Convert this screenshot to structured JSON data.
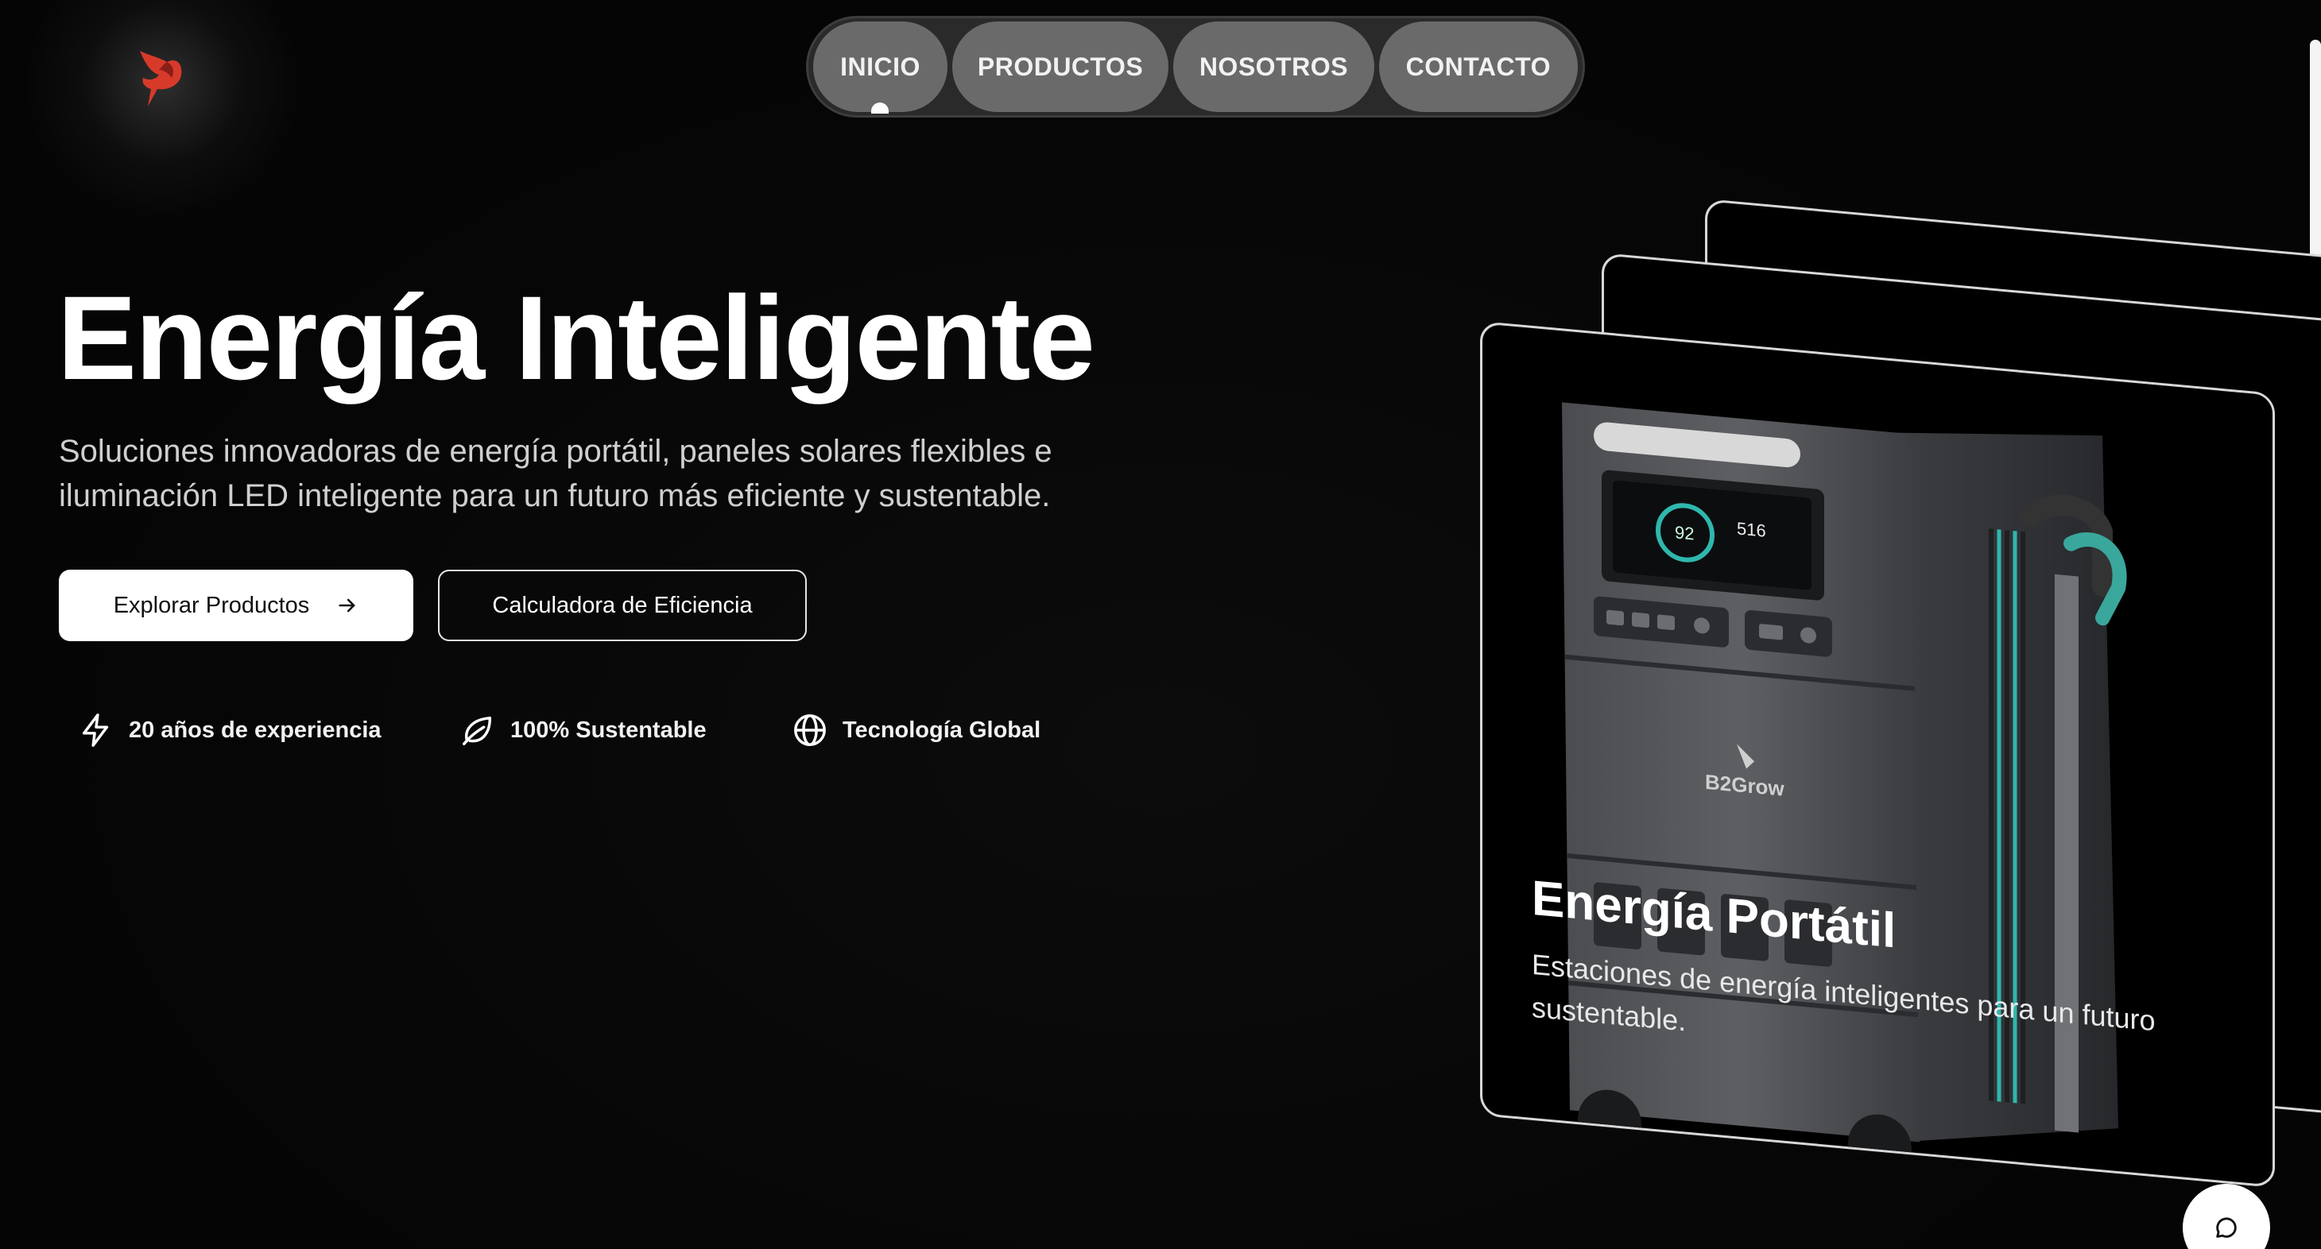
{
  "nav": {
    "items": [
      {
        "label": "INICIO",
        "active": true
      },
      {
        "label": "PRODUCTOS"
      },
      {
        "label": "NOSOTROS"
      },
      {
        "label": "CONTACTO"
      }
    ]
  },
  "brand": {
    "logo_icon": "bird-flame-logo",
    "accent_color": "#e0382a"
  },
  "hero": {
    "title": "Energía Inteligente",
    "subtitle": "Soluciones innovadoras de energía portátil, paneles solares flexibles e iluminación LED inteligente para un futuro más eficiente y sustentable.",
    "primary_button": "Explorar Productos",
    "secondary_button": "Calculadora de Eficiencia"
  },
  "features": [
    {
      "icon": "lightning-icon",
      "label": "20 años de experiencia"
    },
    {
      "icon": "leaf-icon",
      "label": "100% Sustentable"
    },
    {
      "icon": "globe-icon",
      "label": "Tecnología Global"
    }
  ],
  "card": {
    "title": "Energía Portátil",
    "description": "Estaciones de energía inteligentes para un futuro sustentable.",
    "product_brand": "B2Grow",
    "display_readings": [
      "92",
      "516"
    ]
  },
  "chat": {
    "icon": "chat-bubble-icon"
  }
}
